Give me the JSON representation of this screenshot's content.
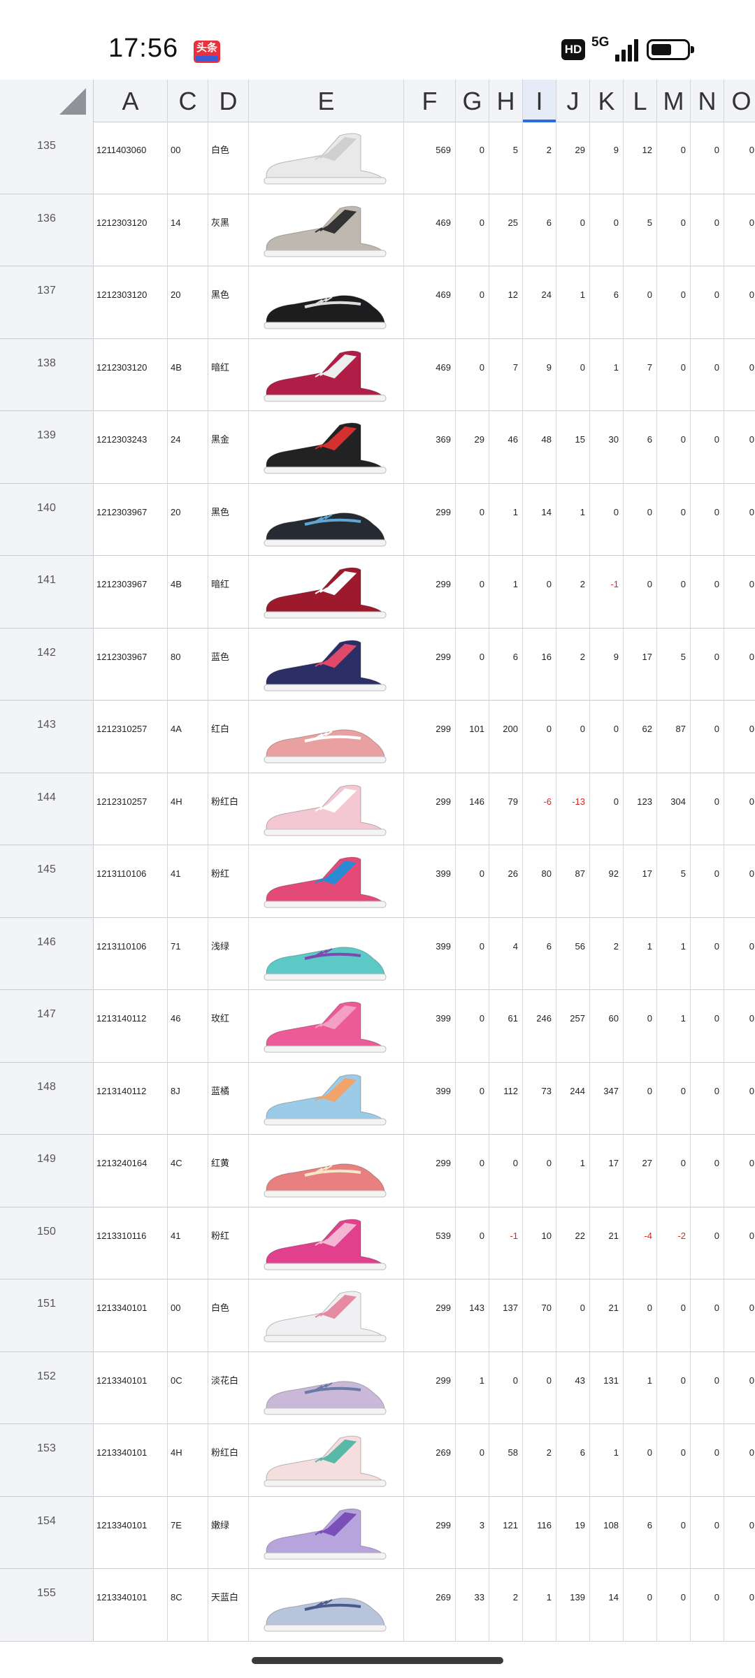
{
  "status_bar": {
    "time": "17:56",
    "news_app_badge": "头条",
    "hd_label": "HD",
    "network": "5G",
    "signal_icon": "signal-bars-icon",
    "battery_icon": "battery-icon"
  },
  "sheet": {
    "columns": [
      "A",
      "C",
      "D",
      "E",
      "F",
      "G",
      "H",
      "I",
      "J",
      "K",
      "L",
      "M",
      "N",
      "O"
    ],
    "selected_column": "I",
    "rows": [
      {
        "num": "135",
        "A": "1211403060",
        "C": "00",
        "D": "白色",
        "shoe_color": "#e9e9e9",
        "shoe_accent": "#cfcfcf",
        "F": "569",
        "G": "0",
        "H": "5",
        "I": "2",
        "J": "29",
        "K": "9",
        "L": "12",
        "M": "0",
        "N": "0",
        "O": "0"
      },
      {
        "num": "136",
        "A": "1212303120",
        "C": "14",
        "D": "灰黑",
        "shoe_color": "#bfb8ae",
        "shoe_accent": "#333333",
        "F": "469",
        "G": "0",
        "H": "25",
        "I": "6",
        "J": "0",
        "K": "0",
        "L": "5",
        "M": "0",
        "N": "0",
        "O": "0"
      },
      {
        "num": "137",
        "A": "1212303120",
        "C": "20",
        "D": "黑色",
        "shoe_color": "#1d1d1f",
        "shoe_accent": "#dddddd",
        "F": "469",
        "G": "0",
        "H": "12",
        "I": "24",
        "J": "1",
        "K": "6",
        "L": "0",
        "M": "0",
        "N": "0",
        "O": "0"
      },
      {
        "num": "138",
        "A": "1212303120",
        "C": "4B",
        "D": "暗红",
        "shoe_color": "#b01e48",
        "shoe_accent": "#eeeeee",
        "F": "469",
        "G": "0",
        "H": "7",
        "I": "9",
        "J": "0",
        "K": "1",
        "L": "7",
        "M": "0",
        "N": "0",
        "O": "0"
      },
      {
        "num": "139",
        "A": "1212303243",
        "C": "24",
        "D": "黑金",
        "shoe_color": "#222222",
        "shoe_accent": "#d43030",
        "F": "369",
        "G": "29",
        "H": "46",
        "I": "48",
        "J": "15",
        "K": "30",
        "L": "6",
        "M": "0",
        "N": "0",
        "O": "0"
      },
      {
        "num": "140",
        "A": "1212303967",
        "C": "20",
        "D": "黑色",
        "shoe_color": "#262b33",
        "shoe_accent": "#5fa8d6",
        "F": "299",
        "G": "0",
        "H": "1",
        "I": "14",
        "J": "1",
        "K": "0",
        "L": "0",
        "M": "0",
        "N": "0",
        "O": "0"
      },
      {
        "num": "141",
        "A": "1212303967",
        "C": "4B",
        "D": "暗红",
        "shoe_color": "#9c1a2b",
        "shoe_accent": "#ffffff",
        "F": "299",
        "G": "0",
        "H": "1",
        "I": "0",
        "J": "2",
        "K": "-1",
        "L": "0",
        "M": "0",
        "N": "0",
        "O": "0"
      },
      {
        "num": "142",
        "A": "1212303967",
        "C": "80",
        "D": "蓝色",
        "shoe_color": "#2c2f66",
        "shoe_accent": "#e04a6a",
        "F": "299",
        "G": "0",
        "H": "6",
        "I": "16",
        "J": "2",
        "K": "9",
        "L": "17",
        "M": "5",
        "N": "0",
        "O": "0"
      },
      {
        "num": "143",
        "A": "1212310257",
        "C": "4A",
        "D": "红白",
        "shoe_color": "#e8a0a0",
        "shoe_accent": "#ffffff",
        "F": "299",
        "G": "101",
        "H": "200",
        "I": "0",
        "J": "0",
        "K": "0",
        "L": "62",
        "M": "87",
        "N": "0",
        "O": "0"
      },
      {
        "num": "144",
        "A": "1212310257",
        "C": "4H",
        "D": "粉红白",
        "shoe_color": "#f3c8d2",
        "shoe_accent": "#ffffff",
        "F": "299",
        "G": "146",
        "H": "79",
        "I": "-6",
        "J": "-13",
        "K": "0",
        "L": "123",
        "M": "304",
        "N": "0",
        "O": "0"
      },
      {
        "num": "145",
        "A": "1213110106",
        "C": "41",
        "D": "粉红",
        "shoe_color": "#e44a78",
        "shoe_accent": "#2a8ad4",
        "F": "399",
        "G": "0",
        "H": "26",
        "I": "80",
        "J": "87",
        "K": "92",
        "L": "17",
        "M": "5",
        "N": "0",
        "O": "0"
      },
      {
        "num": "146",
        "A": "1213110106",
        "C": "71",
        "D": "浅绿",
        "shoe_color": "#5cc9c6",
        "shoe_accent": "#7a4ab0",
        "F": "399",
        "G": "0",
        "H": "4",
        "I": "6",
        "J": "56",
        "K": "2",
        "L": "1",
        "M": "1",
        "N": "0",
        "O": "0"
      },
      {
        "num": "147",
        "A": "1213140112",
        "C": "46",
        "D": "玫红",
        "shoe_color": "#ec5a98",
        "shoe_accent": "#f4a0c4",
        "F": "399",
        "G": "0",
        "H": "61",
        "I": "246",
        "J": "257",
        "K": "60",
        "L": "0",
        "M": "1",
        "N": "0",
        "O": "0"
      },
      {
        "num": "148",
        "A": "1213140112",
        "C": "8J",
        "D": "蓝橘",
        "shoe_color": "#9ccbe8",
        "shoe_accent": "#f2a36a",
        "F": "399",
        "G": "0",
        "H": "112",
        "I": "73",
        "J": "244",
        "K": "347",
        "L": "0",
        "M": "0",
        "N": "0",
        "O": "0"
      },
      {
        "num": "149",
        "A": "1213240164",
        "C": "4C",
        "D": "红黄",
        "shoe_color": "#e88080",
        "shoe_accent": "#f5e8c8",
        "F": "299",
        "G": "0",
        "H": "0",
        "I": "0",
        "J": "1",
        "K": "17",
        "L": "27",
        "M": "0",
        "N": "0",
        "O": "0"
      },
      {
        "num": "150",
        "A": "1213310116",
        "C": "41",
        "D": "粉红",
        "shoe_color": "#e0408c",
        "shoe_accent": "#f4b6d2",
        "F": "539",
        "G": "0",
        "H": "-1",
        "I": "10",
        "J": "22",
        "K": "21",
        "L": "-4",
        "M": "-2",
        "N": "0",
        "O": "0"
      },
      {
        "num": "151",
        "A": "1213340101",
        "C": "00",
        "D": "白色",
        "shoe_color": "#f0f0f2",
        "shoe_accent": "#e58aa0",
        "F": "299",
        "G": "143",
        "H": "137",
        "I": "70",
        "J": "0",
        "K": "21",
        "L": "0",
        "M": "0",
        "N": "0",
        "O": "0"
      },
      {
        "num": "152",
        "A": "1213340101",
        "C": "0C",
        "D": "淡花白",
        "shoe_color": "#c9b8d8",
        "shoe_accent": "#6a7aa8",
        "F": "299",
        "G": "1",
        "H": "0",
        "I": "0",
        "J": "43",
        "K": "131",
        "L": "1",
        "M": "0",
        "N": "0",
        "O": "0"
      },
      {
        "num": "153",
        "A": "1213340101",
        "C": "4H",
        "D": "粉红白",
        "shoe_color": "#f4dede",
        "shoe_accent": "#5ab8a8",
        "F": "269",
        "G": "0",
        "H": "58",
        "I": "2",
        "J": "6",
        "K": "1",
        "L": "0",
        "M": "0",
        "N": "0",
        "O": "0"
      },
      {
        "num": "154",
        "A": "1213340101",
        "C": "7E",
        "D": "嫩绿",
        "shoe_color": "#b8a4dc",
        "shoe_accent": "#7a50b8",
        "F": "299",
        "G": "3",
        "H": "121",
        "I": "116",
        "J": "19",
        "K": "108",
        "L": "6",
        "M": "0",
        "N": "0",
        "O": "0"
      },
      {
        "num": "155",
        "A": "1213340101",
        "C": "8C",
        "D": "天蓝白",
        "shoe_color": "#b8c4dc",
        "shoe_accent": "#4a5a8a",
        "F": "269",
        "G": "33",
        "H": "2",
        "I": "1",
        "J": "139",
        "K": "14",
        "L": "0",
        "M": "0",
        "N": "0",
        "O": "0"
      }
    ]
  }
}
